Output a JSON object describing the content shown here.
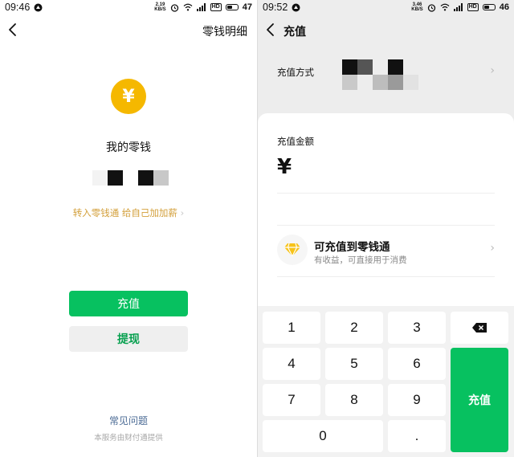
{
  "left": {
    "status": {
      "time": "09:46",
      "speed_top": "2.19",
      "speed_bottom": "KB/S",
      "battery": "47"
    },
    "header": {
      "detail_link": "零钱明细"
    },
    "balance": {
      "coin_symbol": "¥",
      "title": "我的零钱"
    },
    "promo": {
      "text": "转入零钱通 给自己加加薪",
      "chevron": "›"
    },
    "buttons": {
      "recharge": "充值",
      "withdraw": "提现"
    },
    "footer": {
      "faq": "常见问题",
      "provider": "本服务由财付通提供"
    }
  },
  "right": {
    "status": {
      "time": "09:52",
      "speed_top": "3.46",
      "speed_bottom": "KB/S",
      "battery": "46"
    },
    "header": {
      "title": "充值"
    },
    "method": {
      "label": "充值方式",
      "chevron": "›"
    },
    "amount": {
      "label": "充值金额",
      "currency": "¥"
    },
    "promo": {
      "title": "可充值到零钱通",
      "subtitle": "有收益，可直接用于消费",
      "chevron": "›"
    },
    "keypad": {
      "keys": [
        "1",
        "2",
        "3",
        "4",
        "5",
        "6",
        "7",
        "8",
        "9",
        "0",
        "."
      ],
      "confirm": "充值",
      "backspace_icon": "backspace-icon"
    }
  },
  "colors": {
    "accent": "#07c160",
    "coin": "#f5b800",
    "promo": "#d39f3a",
    "link": "#4a6a94"
  }
}
